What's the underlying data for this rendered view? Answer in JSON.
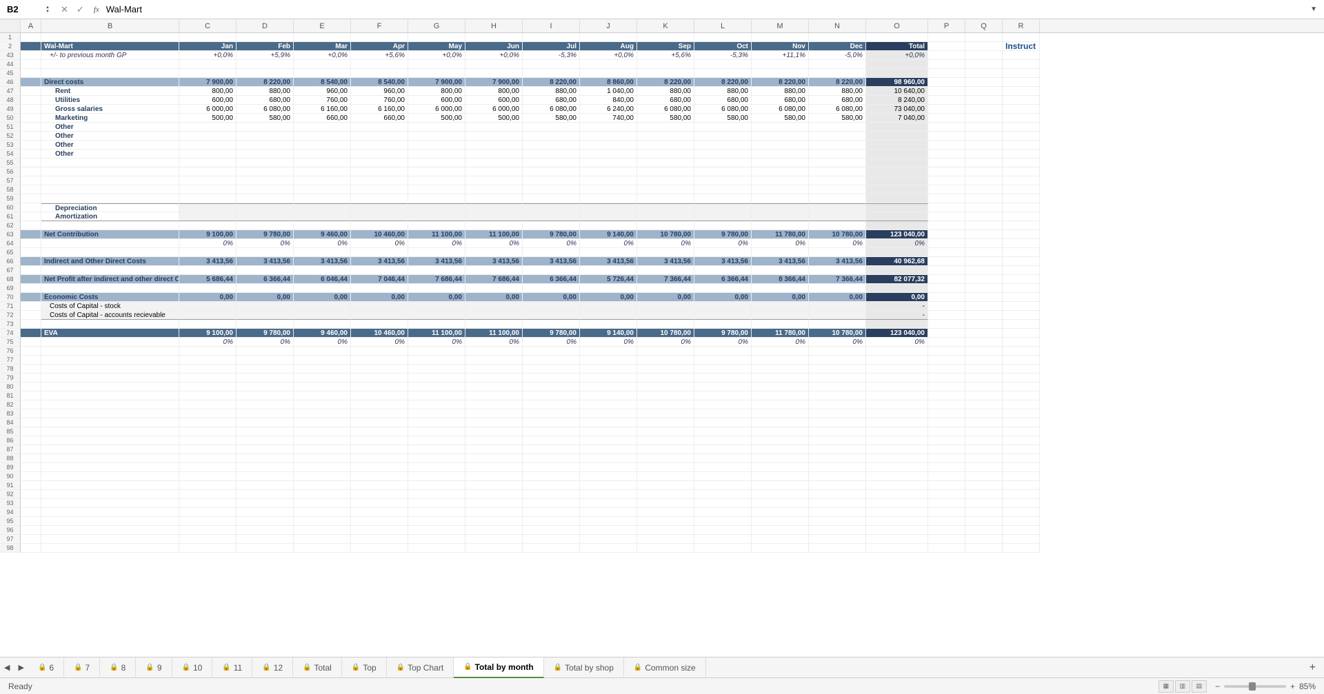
{
  "cellRef": "B2",
  "formulaValue": "Wal-Mart",
  "instructLabel": "Instruct",
  "columns": [
    "A",
    "B",
    "C",
    "D",
    "E",
    "F",
    "G",
    "H",
    "I",
    "J",
    "K",
    "L",
    "M",
    "N",
    "O",
    "P",
    "Q",
    "R"
  ],
  "rowNums": [
    1,
    2,
    43,
    44,
    45,
    46,
    47,
    48,
    49,
    50,
    51,
    52,
    53,
    54,
    55,
    56,
    57,
    58,
    59,
    60,
    61,
    62,
    63,
    64,
    65,
    66,
    67,
    68,
    69,
    70,
    71,
    72,
    73,
    74,
    75,
    76,
    77,
    78,
    79,
    80,
    81,
    82,
    83,
    84,
    85,
    86,
    87,
    88,
    89,
    90,
    91,
    92,
    93,
    94,
    95,
    96,
    97,
    98
  ],
  "headerRow": {
    "title": "Wal-Mart",
    "months": [
      "Jan",
      "Feb",
      "Mar",
      "Apr",
      "May",
      "Jun",
      "Jul",
      "Aug",
      "Sep",
      "Oct",
      "Nov",
      "Dec"
    ],
    "total": "Total"
  },
  "gpRow": {
    "label": "+/- to previous month GP",
    "vals": [
      "+0,0%",
      "+5,9%",
      "+0,0%",
      "+5,6%",
      "+0,0%",
      "+0,0%",
      "-5,3%",
      "+0,0%",
      "+5,6%",
      "-5,3%",
      "+11,1%",
      "-5,0%"
    ],
    "total": "+0,0%"
  },
  "directCosts": {
    "label": "Direct costs",
    "vals": [
      "7 900,00",
      "8 220,00",
      "8 540,00",
      "8 540,00",
      "7 900,00",
      "7 900,00",
      "8 220,00",
      "8 860,00",
      "8 220,00",
      "8 220,00",
      "8 220,00",
      "8 220,00"
    ],
    "total": "98 960,00",
    "rows": [
      {
        "label": "Rent",
        "vals": [
          "800,00",
          "880,00",
          "960,00",
          "960,00",
          "800,00",
          "800,00",
          "880,00",
          "1 040,00",
          "880,00",
          "880,00",
          "880,00",
          "880,00"
        ],
        "total": "10 640,00"
      },
      {
        "label": "Utilities",
        "vals": [
          "600,00",
          "680,00",
          "760,00",
          "760,00",
          "600,00",
          "600,00",
          "680,00",
          "840,00",
          "680,00",
          "680,00",
          "680,00",
          "680,00"
        ],
        "total": "8 240,00"
      },
      {
        "label": "Gross salaries",
        "vals": [
          "6 000,00",
          "6 080,00",
          "6 160,00",
          "6 160,00",
          "6 000,00",
          "6 000,00",
          "6 080,00",
          "6 240,00",
          "6 080,00",
          "6 080,00",
          "6 080,00",
          "6 080,00"
        ],
        "total": "73 040,00"
      },
      {
        "label": "Marketing",
        "vals": [
          "500,00",
          "580,00",
          "660,00",
          "660,00",
          "500,00",
          "500,00",
          "580,00",
          "740,00",
          "580,00",
          "580,00",
          "580,00",
          "580,00"
        ],
        "total": "7 040,00"
      },
      {
        "label": "Other",
        "vals": [
          "",
          "",
          "",
          "",
          "",
          "",
          "",
          "",
          "",
          "",
          "",
          ""
        ],
        "total": ""
      },
      {
        "label": "Other",
        "vals": [
          "",
          "",
          "",
          "",
          "",
          "",
          "",
          "",
          "",
          "",
          "",
          ""
        ],
        "total": ""
      },
      {
        "label": "Other",
        "vals": [
          "",
          "",
          "",
          "",
          "",
          "",
          "",
          "",
          "",
          "",
          "",
          ""
        ],
        "total": ""
      },
      {
        "label": "Other",
        "vals": [
          "",
          "",
          "",
          "",
          "",
          "",
          "",
          "",
          "",
          "",
          "",
          ""
        ],
        "total": ""
      }
    ]
  },
  "depreciation": {
    "label": "Depreciation"
  },
  "amortization": {
    "label": "Amortization"
  },
  "netContrib": {
    "label": "Net Contribution",
    "vals": [
      "9 100,00",
      "9 780,00",
      "9 460,00",
      "10 460,00",
      "11 100,00",
      "11 100,00",
      "9 780,00",
      "9 140,00",
      "10 780,00",
      "9 780,00",
      "11 780,00",
      "10 780,00"
    ],
    "total": "123 040,00",
    "pct": [
      "0%",
      "0%",
      "0%",
      "0%",
      "0%",
      "0%",
      "0%",
      "0%",
      "0%",
      "0%",
      "0%",
      "0%"
    ],
    "pctTotal": "0%"
  },
  "indirect": {
    "label": "Indirect and Other Direct Costs",
    "vals": [
      "3 413,56",
      "3 413,56",
      "3 413,56",
      "3 413,56",
      "3 413,56",
      "3 413,56",
      "3 413,56",
      "3 413,56",
      "3 413,56",
      "3 413,56",
      "3 413,56",
      "3 413,56"
    ],
    "total": "40 962,68"
  },
  "netProfit": {
    "label": "Net Profit after indirect and other direct C",
    "vals": [
      "5 686,44",
      "6 366,44",
      "6 046,44",
      "7 046,44",
      "7 686,44",
      "7 686,44",
      "6 366,44",
      "5 726,44",
      "7 366,44",
      "6 366,44",
      "8 366,44",
      "7 366,44"
    ],
    "total": "82 077,32"
  },
  "economic": {
    "label": "Economic Costs",
    "vals": [
      "0,00",
      "0,00",
      "0,00",
      "0,00",
      "0,00",
      "0,00",
      "0,00",
      "0,00",
      "0,00",
      "0,00",
      "0,00",
      "0,00"
    ],
    "total": "0,00"
  },
  "capStock": {
    "label": "Costs of Capital - stock",
    "total": "-"
  },
  "capAR": {
    "label": "Costs of Capital - accounts recievable",
    "total": "-"
  },
  "eva": {
    "label": "EVA",
    "vals": [
      "9 100,00",
      "9 780,00",
      "9 460,00",
      "10 460,00",
      "11 100,00",
      "11 100,00",
      "9 780,00",
      "9 140,00",
      "10 780,00",
      "9 780,00",
      "11 780,00",
      "10 780,00"
    ],
    "total": "123 040,00",
    "pct": [
      "0%",
      "0%",
      "0%",
      "0%",
      "0%",
      "0%",
      "0%",
      "0%",
      "0%",
      "0%",
      "0%",
      "0%"
    ],
    "pctTotal": "0%"
  },
  "tabs": [
    {
      "label": "6",
      "locked": true
    },
    {
      "label": "7",
      "locked": true
    },
    {
      "label": "8",
      "locked": true
    },
    {
      "label": "9",
      "locked": true
    },
    {
      "label": "10",
      "locked": true
    },
    {
      "label": "11",
      "locked": true
    },
    {
      "label": "12",
      "locked": true
    },
    {
      "label": "Total",
      "locked": true
    },
    {
      "label": "Top",
      "locked": true
    },
    {
      "label": "Top Chart",
      "locked": true
    },
    {
      "label": "Total by month",
      "locked": true,
      "active": true
    },
    {
      "label": "Total by shop",
      "locked": true
    },
    {
      "label": "Common size",
      "locked": true
    }
  ],
  "status": "Ready",
  "zoom": "85%"
}
